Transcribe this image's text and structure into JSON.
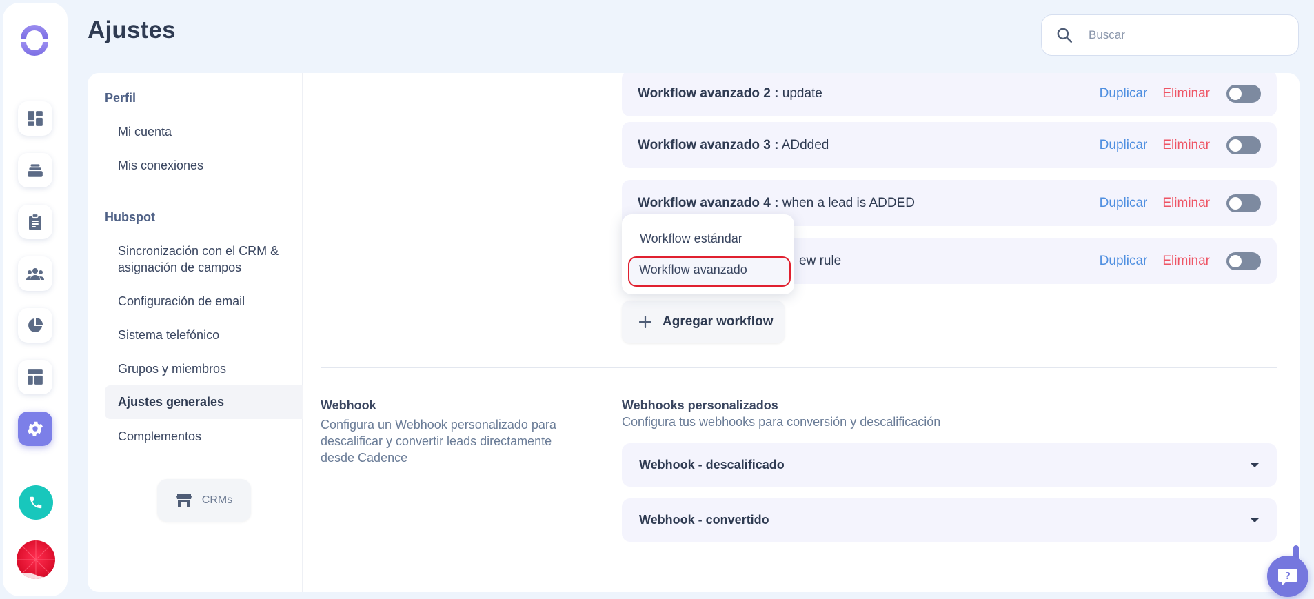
{
  "header": {
    "title": "Ajustes",
    "search_placeholder": "Buscar"
  },
  "rail": {
    "icons": [
      "logo-icon",
      "dashboard-icon",
      "inbox-stack-icon",
      "clipboard-icon",
      "team-icon",
      "pie-chart-icon",
      "layout-icon",
      "gear-icon",
      "phone-icon",
      "avatar"
    ]
  },
  "nav": {
    "sections": [
      {
        "label": "Perfil",
        "items": [
          "Mi cuenta",
          "Mis conexiones"
        ]
      },
      {
        "label": "Hubspot",
        "items": [
          "Sincronización con el CRM & asignación de campos",
          "Configuración de email",
          "Sistema telefónico",
          "Grupos y miembros",
          "Ajustes generales",
          "Complementos"
        ]
      }
    ],
    "active_item": "Ajustes generales",
    "crm_button": "CRMs"
  },
  "workflows": {
    "items": [
      {
        "name": "Workflow avanzado 2 :",
        "detail": "update"
      },
      {
        "name": "Workflow avanzado 3 :",
        "detail": "ADdded"
      },
      {
        "name": "Workflow avanzado 4 :",
        "detail": "when a lead is ADDED"
      },
      {
        "name": "",
        "detail": "ew rule"
      }
    ],
    "duplicate_label": "Duplicar",
    "delete_label": "Eliminar",
    "add_label": "Agregar workflow",
    "dropdown": {
      "options": [
        "Workflow estándar",
        "Workflow avanzado"
      ],
      "highlighted": "Workflow avanzado"
    }
  },
  "webhook": {
    "title": "Webhook",
    "description": "Configura un Webhook personalizado para descalificar y convertir leads directamente desde Cadence",
    "custom_title": "Webhooks personalizados",
    "custom_description": "Configura tus webhooks para conversión y descalificación",
    "items": [
      "Webhook - descalificado",
      "Webhook - convertido"
    ]
  },
  "colors": {
    "accent": "#7c7fe8",
    "duplicate": "#4f8fe0",
    "delete": "#ee5565",
    "phone": "#18c7bc"
  }
}
